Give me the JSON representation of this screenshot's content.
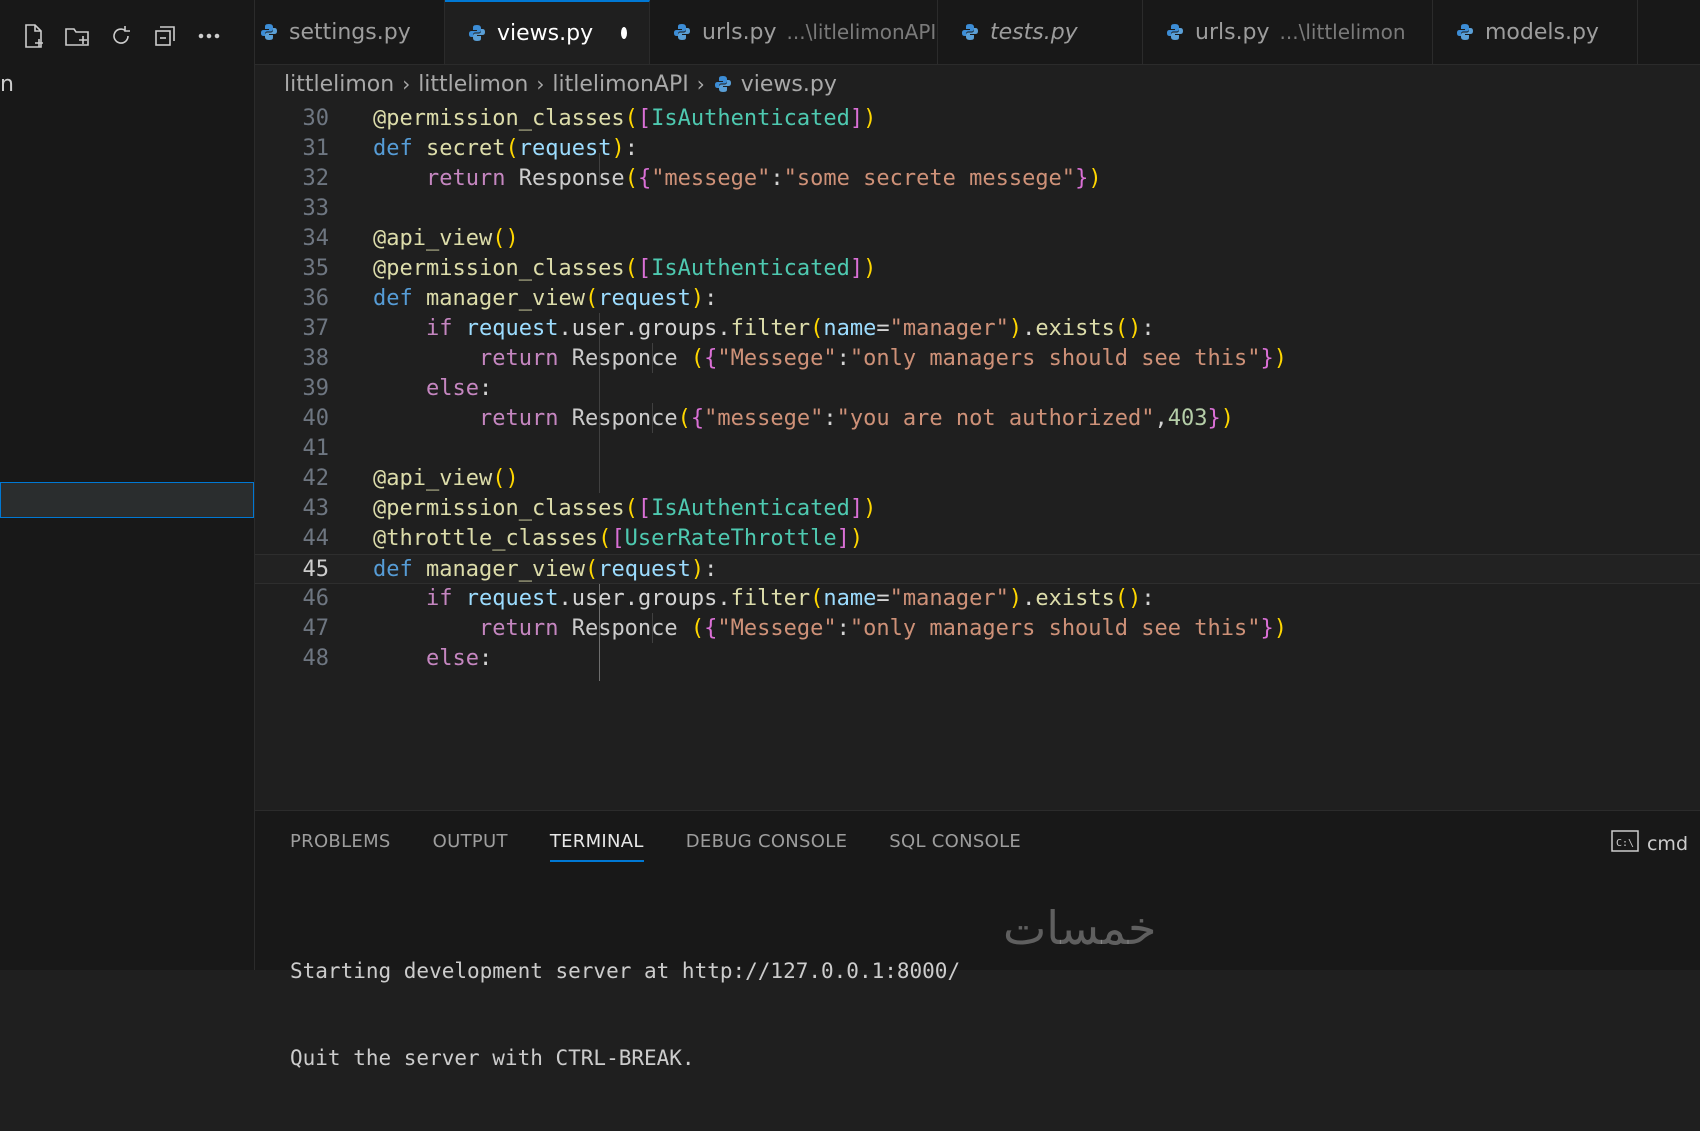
{
  "sidebar": {
    "stub_text": "n",
    "toolbar": [
      {
        "icon": "new-file-icon"
      },
      {
        "icon": "new-folder-icon"
      },
      {
        "icon": "refresh-icon"
      },
      {
        "icon": "collapse-all-icon"
      },
      {
        "icon": "more-icon"
      }
    ]
  },
  "tabs": [
    {
      "label": "settings.py",
      "description": "",
      "dirty": false,
      "active": false,
      "italic": false
    },
    {
      "label": "views.py",
      "description": "",
      "dirty": true,
      "active": true,
      "italic": false
    },
    {
      "label": "urls.py",
      "description": "...\\litlelimonAPI",
      "dirty": false,
      "active": false,
      "italic": false
    },
    {
      "label": "tests.py",
      "description": "",
      "dirty": false,
      "active": false,
      "italic": true
    },
    {
      "label": "urls.py",
      "description": "...\\littlelimon",
      "dirty": false,
      "active": false,
      "italic": false
    },
    {
      "label": "models.py",
      "description": "",
      "dirty": true,
      "active": false,
      "italic": false
    }
  ],
  "breadcrumb": {
    "items": [
      "littlelimon",
      "littlelimon",
      "litlelimonAPI"
    ],
    "file": "views.py"
  },
  "editor": {
    "current_line": 45,
    "lines": [
      {
        "n": "30",
        "code": "@permission_classes([IsAuthenticated])"
      },
      {
        "n": "31",
        "code": "def secret(request):"
      },
      {
        "n": "32",
        "code": "    return Response({\"messege\":\"some secrete messege\"})"
      },
      {
        "n": "33",
        "code": ""
      },
      {
        "n": "34",
        "code": "@api_view()"
      },
      {
        "n": "35",
        "code": "@permission_classes([IsAuthenticated])"
      },
      {
        "n": "36",
        "code": "def manager_view(request):"
      },
      {
        "n": "37",
        "code": "    if request.user.groups.filter(name=\"manager\").exists():"
      },
      {
        "n": "38",
        "code": "        return Responce ({\"Messege\":\"only managers should see this\"})"
      },
      {
        "n": "39",
        "code": "    else:"
      },
      {
        "n": "40",
        "code": "        return Responce({\"messege\":\"you are not authorized\",403})"
      },
      {
        "n": "41",
        "code": ""
      },
      {
        "n": "42",
        "code": "@api_view()"
      },
      {
        "n": "43",
        "code": "@permission_classes([IsAuthenticated])"
      },
      {
        "n": "44",
        "code": "@throttle_classes([UserRateThrottle])"
      },
      {
        "n": "45",
        "code": "def manager_view(request):"
      },
      {
        "n": "46",
        "code": "    if request.user.groups.filter(name=\"manager\").exists():"
      },
      {
        "n": "47",
        "code": "        return Responce ({\"Messege\":\"only managers should see this\"})"
      },
      {
        "n": "48",
        "code": "    else:"
      }
    ]
  },
  "panel": {
    "tabs": [
      "PROBLEMS",
      "OUTPUT",
      "TERMINAL",
      "DEBUG CONSOLE",
      "SQL CONSOLE"
    ],
    "active_tab": "TERMINAL",
    "shell": "cmd",
    "terminal_lines": [
      "Starting development server at http://127.0.0.1:8000/",
      "Quit the server with CTRL-BREAK."
    ],
    "watermark": "خمسات"
  }
}
